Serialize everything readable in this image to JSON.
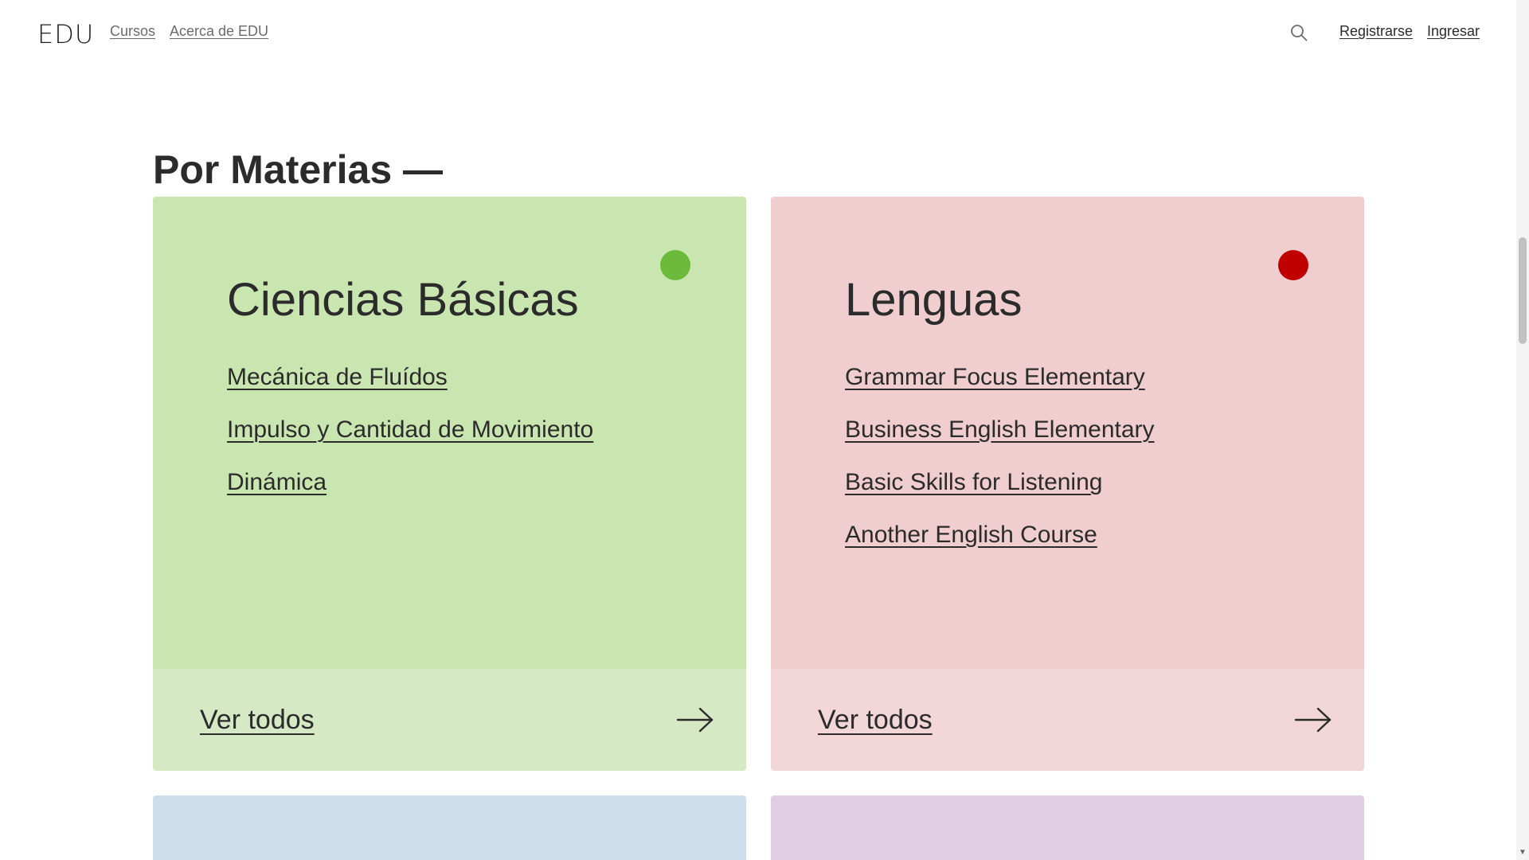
{
  "header": {
    "logo": "EDU",
    "nav": [
      {
        "label": "Cursos"
      },
      {
        "label": "Acerca de EDU"
      }
    ],
    "search_icon": "search-icon",
    "register_label": "Registrarse",
    "login_label": "Ingresar"
  },
  "section": {
    "title": "Por Materias —"
  },
  "cards": [
    {
      "title": "Ciencias Básicas",
      "dot_color": "#6cba3c",
      "bg_color": "#c9e5b0",
      "courses": [
        {
          "label": "Mecánica de Fluídos"
        },
        {
          "label": "Impulso y Cantidad de Movimiento"
        },
        {
          "label": "Dinámica"
        }
      ],
      "see_all_label": "Ver todos",
      "arrow_icon": "arrow-right-icon"
    },
    {
      "title": "Lenguas",
      "dot_color": "#c00000",
      "bg_color": "#f0cdcf",
      "courses": [
        {
          "label": "Grammar Focus Elementary"
        },
        {
          "label": "Business English Elementary"
        },
        {
          "label": "Basic Skills for Listening"
        },
        {
          "label": "Another English Course"
        }
      ],
      "see_all_label": "Ver todos",
      "arrow_icon": "arrow-right-icon"
    }
  ],
  "colors": {
    "card_blue": "#cfdeec",
    "card_purple": "#e0cde4"
  }
}
